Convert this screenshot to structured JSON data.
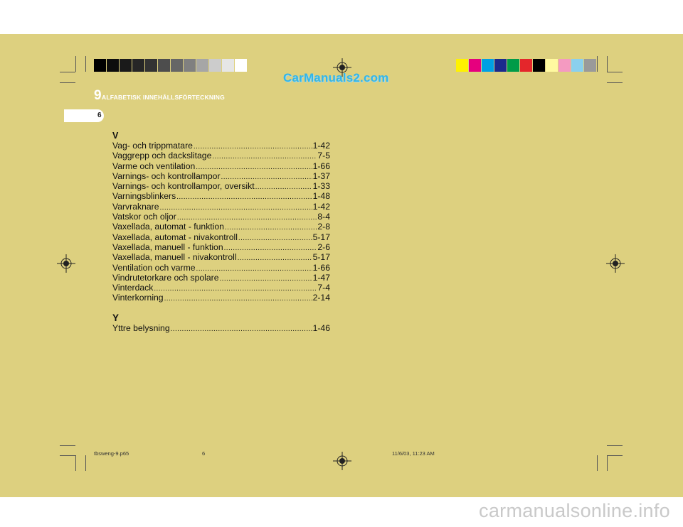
{
  "header": {
    "chapter_number": "9",
    "title": "ALFABETISK INNEHÅLLSFÖRTECKNING",
    "page_tab": "6"
  },
  "watermark_top": "CarManuals2.com",
  "watermark_bottom": "carmanualsonline.info",
  "index": {
    "section_v": {
      "letter": "V",
      "entries": [
        {
          "label": "Vag- och trippmatare",
          "page": "1-42"
        },
        {
          "label": "Vaggrepp och dackslitage",
          "page": "7-5"
        },
        {
          "label": "Varme och ventilation",
          "page": "1-66"
        },
        {
          "label": "Varnings- och kontrollampor",
          "page": "1-37"
        },
        {
          "label": "Varnings- och kontrollampor, oversikt",
          "page": "1-33"
        },
        {
          "label": "Varningsblinkers",
          "page": "1-48"
        },
        {
          "label": "Varvraknare",
          "page": "1-42"
        },
        {
          "label": "Vatskor och oljor",
          "page": "8-4"
        },
        {
          "label": "Vaxellada, automat - funktion",
          "page": "2-8"
        },
        {
          "label": "Vaxellada, automat - nivakontroll",
          "page": "5-17"
        },
        {
          "label": "Vaxellada, manuell - funktion",
          "page": "2-6"
        },
        {
          "label": "Vaxellada, manuell - nivakontroll",
          "page": "5-17"
        },
        {
          "label": "Ventilation och varme",
          "page": "1-66"
        },
        {
          "label": "Vindrutetorkare och spolare",
          "page": "1-47"
        },
        {
          "label": "Vinterdack",
          "page": "7-4"
        },
        {
          "label": "Vinterkorning",
          "page": "2-14"
        }
      ]
    },
    "section_y": {
      "letter": "Y",
      "entries": [
        {
          "label": "Yttre belysning",
          "page": "1-46"
        }
      ]
    }
  },
  "footer": {
    "file": "tbsweng-9.p65",
    "page": "6",
    "datetime": "11/6/03, 11:23 AM"
  },
  "colors": {
    "page_background": "#ddd07f",
    "grayscale": [
      "#000000",
      "#0d0d0d",
      "#1a1a1a",
      "#262626",
      "#333333",
      "#4d4d4d",
      "#666666",
      "#808080",
      "#a6a6a6",
      "#cccccc",
      "#e6e6e6",
      "#ffffff"
    ],
    "colorbar": [
      "#fff200",
      "#e6007e",
      "#00a0e3",
      "#1b2a8c",
      "#009b48",
      "#e4262b",
      "#000000",
      "#fff9a0",
      "#f49ac1",
      "#8ad0ee",
      "#9a9a9a"
    ]
  }
}
